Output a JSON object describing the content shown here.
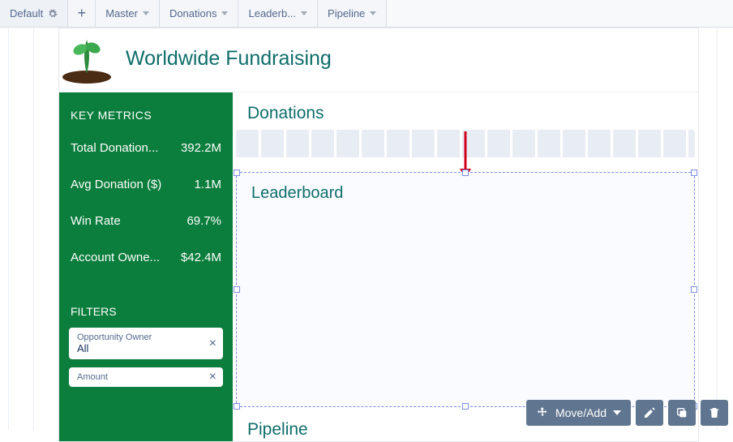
{
  "tabs": {
    "default_label": "Default",
    "items": [
      {
        "label": "Master"
      },
      {
        "label": "Donations"
      },
      {
        "label": "Leaderb..."
      },
      {
        "label": "Pipeline"
      }
    ]
  },
  "header": {
    "title": "Worldwide Fundraising"
  },
  "sidebar": {
    "metrics_header": "KEY METRICS",
    "metrics": [
      {
        "label": "Total Donation...",
        "value": "392.2M"
      },
      {
        "label": "Avg Donation ($)",
        "value": "1.1M"
      },
      {
        "label": "Win Rate",
        "value": "69.7%"
      },
      {
        "label": "Account Owne...",
        "value": "$42.4M"
      }
    ],
    "filters_header": "FILTERS",
    "filters": [
      {
        "label": "Opportunity Owner",
        "value": "All"
      },
      {
        "label": "Amount",
        "value": ""
      }
    ]
  },
  "main": {
    "donations_title": "Donations",
    "leaderboard_title": "Leaderboard",
    "pipeline_title": "Pipeline"
  },
  "toolbar": {
    "move_add": "Move/Add"
  },
  "colors": {
    "brand_green": "#0b7d3c",
    "teal": "#0f6e6a",
    "toolbar": "#60758f"
  }
}
